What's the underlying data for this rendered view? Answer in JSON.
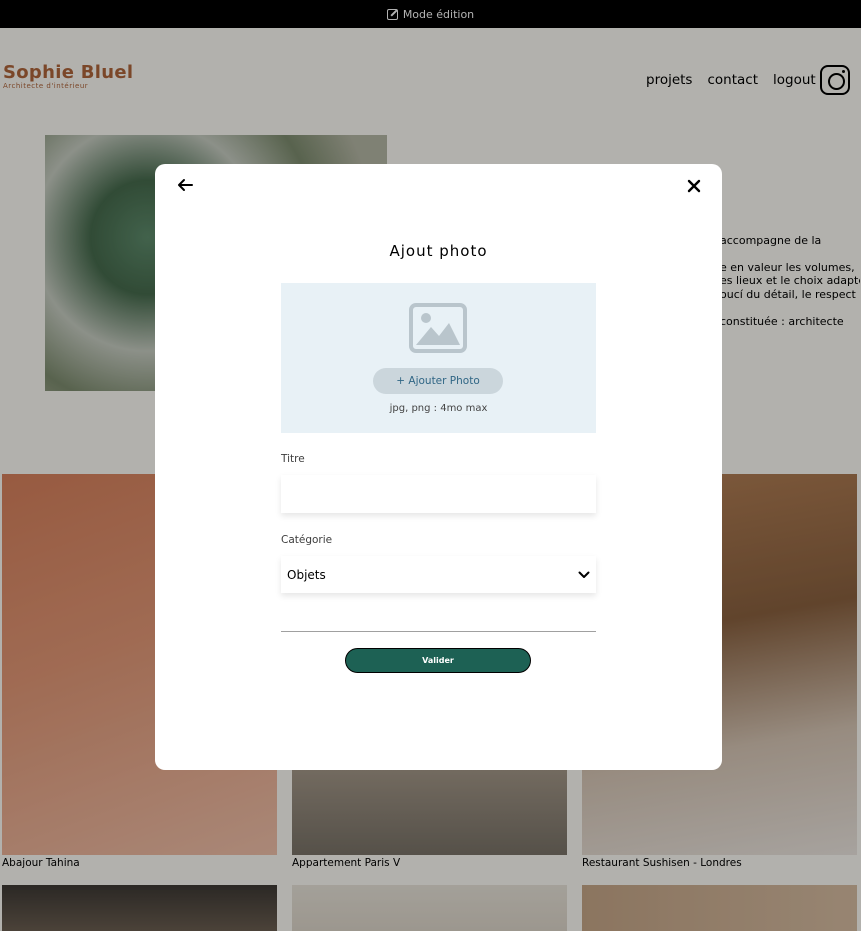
{
  "edit_bar": {
    "label": "Mode édition"
  },
  "header": {
    "logo_name": "Sophie Bluel",
    "logo_subtitle": "Architecte d'intérieur",
    "nav": [
      "projets",
      "contact",
      "logout"
    ]
  },
  "intro": {
    "lines": [
      "accompagne de la",
      "e en valeur les volumes,",
      "es lieux et le choix adapté",
      "oucí du détail, le respect",
      "constituée : architecte"
    ]
  },
  "gallery": [
    {
      "caption": "Abajour Tahina"
    },
    {
      "caption": "Appartement Paris V"
    },
    {
      "caption": "Restaurant Sushisen - Londres"
    }
  ],
  "modal": {
    "title": "Ajout photo",
    "upload": {
      "button_label": "+ Ajouter Photo",
      "hint": "jpg, png : 4mo max"
    },
    "title_field": {
      "label": "Titre",
      "value": ""
    },
    "category_field": {
      "label": "Catégorie",
      "value": "Objets"
    },
    "submit_label": "Valider"
  },
  "colors": {
    "accent": "#1d6154",
    "brand": "#b1663c",
    "upload_bg": "#e8f1f6"
  }
}
